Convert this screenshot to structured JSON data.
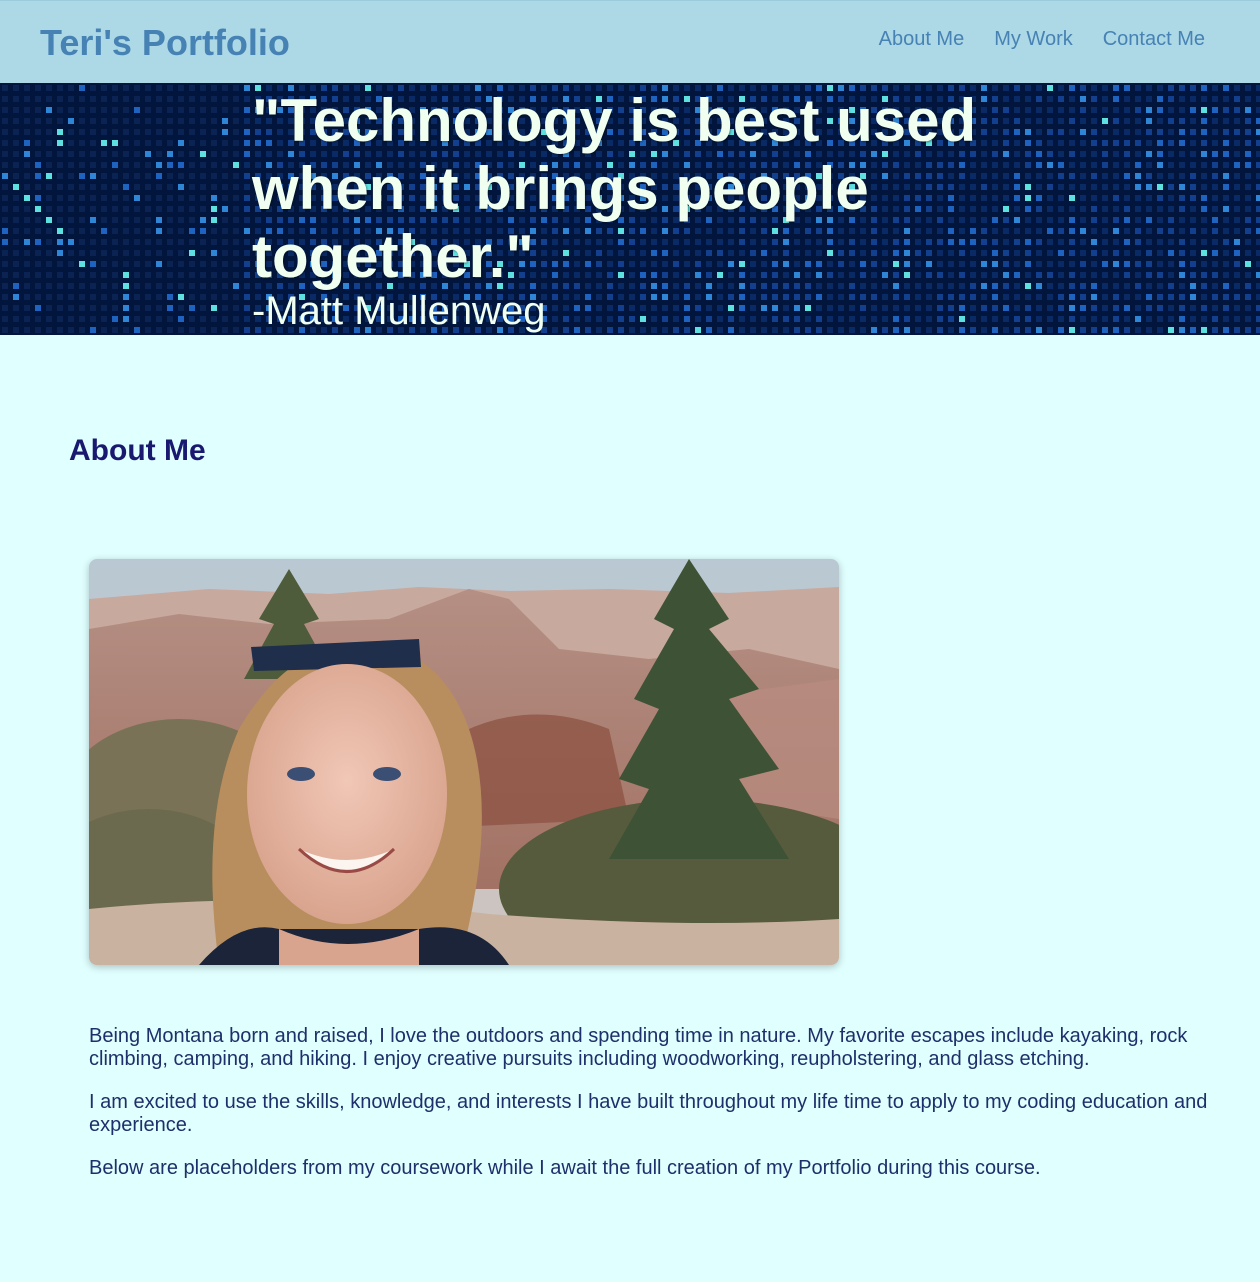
{
  "header": {
    "title": "Teri's Portfolio",
    "nav": [
      {
        "label": "About Me"
      },
      {
        "label": "My Work"
      },
      {
        "label": "Contact Me"
      }
    ]
  },
  "hero": {
    "quote": "\"Technology is best used when it brings people together.\"",
    "author": "-Matt Mullenweg"
  },
  "about": {
    "heading": "About Me",
    "paragraphs": [
      "Being Montana born and raised, I love the outdoors and spending time in nature. My favorite escapes include kayaking, rock climbing, camping, and hiking. I enjoy creative pursuits including woodworking, reupholstering, and glass etching.",
      "I am excited to use the skills, knowledge, and interests I have built throughout my life time to apply to my coding education and experience.",
      "Below are placeholders from my coursework while I await the full creation of my Portfolio during this course."
    ]
  },
  "colors": {
    "header_bg": "#add8e6",
    "page_bg": "#e0ffff",
    "title": "#4682b4",
    "heading": "#191970",
    "text": "#1f2f6b"
  }
}
